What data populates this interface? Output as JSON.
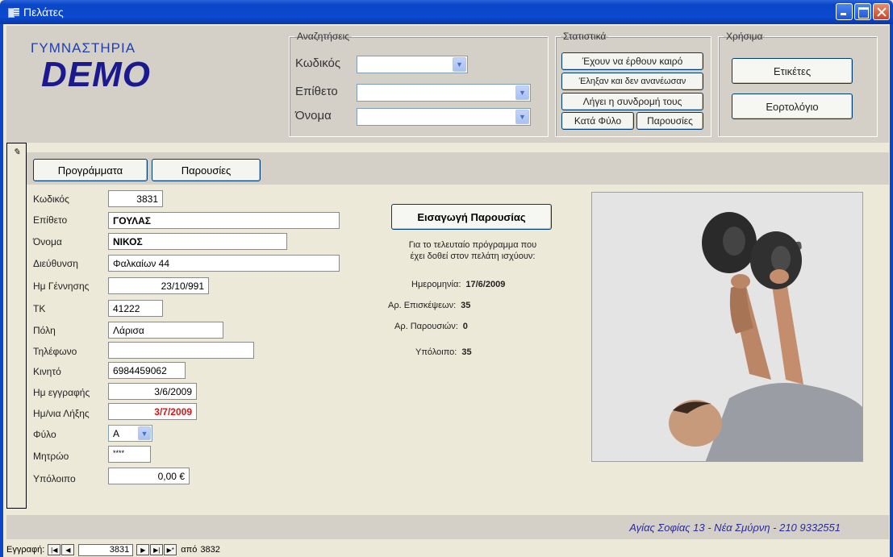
{
  "window": {
    "title": "Πελάτες"
  },
  "logo": {
    "top": "ΓΥΜΝΑΣΤΗΡΙΑ",
    "main": "DEMO"
  },
  "search": {
    "legend": "Αναζητήσεις",
    "code_label": "Κωδικός",
    "surname_label": "Επίθετο",
    "name_label": "Όνομα"
  },
  "stats": {
    "legend": "Στατιστικά",
    "btn1": "Έχουν να έρθουν καιρό",
    "btn2": "Έληξαν και δεν ανανέωσαν",
    "btn3": "Λήγει η συνδρομή τους",
    "btn4": "Κατά Φύλο",
    "btn5": "Παρουσίες"
  },
  "useful": {
    "legend": "Χρήσιμα",
    "labels_btn": "Ετικέτες",
    "namedays_btn": "Εορτολόγιο"
  },
  "tabs": {
    "programs": "Προγράμματα",
    "attendance": "Παρουσίες"
  },
  "fields": {
    "code_label": "Κωδικός",
    "code_value": "3831",
    "surname_label": "Επίθετο",
    "surname_value": "ΓΟΥΛΑΣ",
    "name_label": "Όνομα",
    "name_value": "ΝΙΚΟΣ",
    "address_label": "Διεύθυνση",
    "address_value": "Φαλκαίων 44",
    "birth_label": "Ημ Γέννησης",
    "birth_value": "23/10/991",
    "zip_label": "ΤΚ",
    "zip_value": "41222",
    "city_label": "Πόλη",
    "city_value": "Λάρισα",
    "phone_label": "Τηλέφωνο",
    "phone_value": "",
    "mobile_label": "Κινητό",
    "mobile_value": "6984459062",
    "reg_label": "Ημ εγγραφής",
    "reg_value": "3/6/2009",
    "expire_label": "Ημ/νια Λήξης",
    "expire_value": "3/7/2009",
    "gender_label": "Φύλο",
    "gender_value": "Α",
    "registry_label": "Μητρώο",
    "registry_value": "****",
    "balance_label": "Υπόλοιπο",
    "balance_value": "0,00 €"
  },
  "attendance": {
    "button": "Εισαγωγή Παρουσίας",
    "note_line1": "Για το τελευταίο πρόγραμμα που",
    "note_line2": "έχει δοθεί στον πελάτη ισχύουν:",
    "date_label": "Ημερομηνία:",
    "date_value": "17/6/2009",
    "visits_label": "Αρ. Επισκέψεων:",
    "visits_value": "35",
    "presences_label": "Αρ. Παρουσιών:",
    "presences_value": "0",
    "balance_label": "Υπόλοιπο:",
    "balance_value": "35"
  },
  "footer": {
    "address": "Αγίας Σοφίας 13 - Νέα Σμύρνη - 210 9332551"
  },
  "nav": {
    "record_label": "Εγγραφή:",
    "current": "3831",
    "of_label": "από",
    "total": "3832"
  }
}
